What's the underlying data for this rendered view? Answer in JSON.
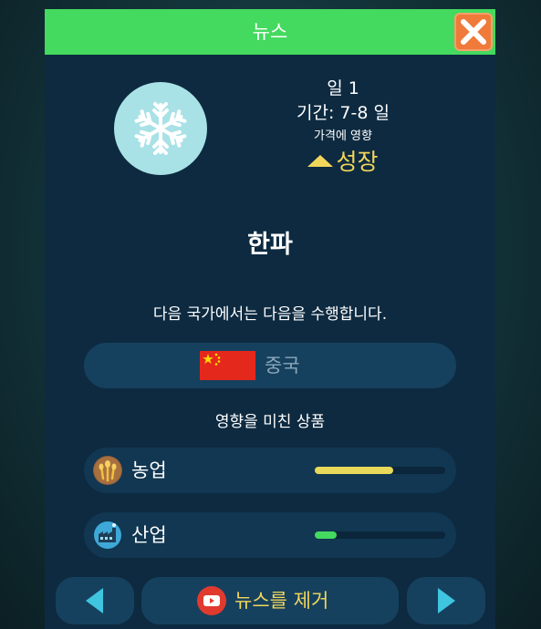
{
  "dialog": {
    "title": "뉴스",
    "close_icon": "close-icon",
    "accent": "#44d95f"
  },
  "event": {
    "icon": "snowflake-icon",
    "day": "일 1",
    "duration": "기간: 7-8 일",
    "impact_label": "가격에 영향",
    "trend": "성장",
    "trend_icon": "up-arrow-icon",
    "name": "한파",
    "description": "다음 국가에서는 다음을 수행합니다."
  },
  "country": {
    "name": "중국",
    "flag_icon": "china-flag-icon"
  },
  "goods": {
    "label": "영향을 미친 상품",
    "items": [
      {
        "name": "농업",
        "icon": "wheat-icon",
        "level": 0.6,
        "color": "#e8d95a"
      },
      {
        "name": "산업",
        "icon": "factory-icon",
        "level": 0.17,
        "color": "#44d95f"
      }
    ]
  },
  "footer": {
    "prev_icon": "arrow-left-icon",
    "remove_label": "뉴스를 제거",
    "remove_icon": "video-icon",
    "next_icon": "arrow-right-icon"
  }
}
